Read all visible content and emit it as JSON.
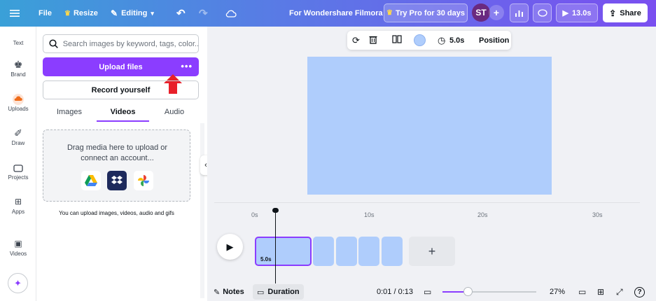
{
  "topbar": {
    "file": "File",
    "resize": "Resize",
    "editing": "Editing",
    "doc_title": "For Wondershare Filmora",
    "try_pro": "Try Pro for 30 days",
    "avatar": "ST",
    "play_duration": "13.0s",
    "share": "Share"
  },
  "rail": {
    "text": "Text",
    "brand": "Brand",
    "uploads": "Uploads",
    "draw": "Draw",
    "projects": "Projects",
    "apps": "Apps",
    "videos": "Videos"
  },
  "panel": {
    "search_placeholder": "Search images by keyword, tags, color...",
    "upload_label": "Upload files",
    "record_label": "Record yourself",
    "tabs": [
      "Images",
      "Videos",
      "Audio"
    ],
    "drop_text": "Drag media here to upload or connect an account...",
    "hint": "You can upload images, videos, audio and gifs"
  },
  "context_toolbar": {
    "duration": "5.0s",
    "position": "Position"
  },
  "timeline": {
    "ticks": [
      "0s",
      "10s",
      "20s",
      "30s"
    ],
    "clip_duration": "5.0s"
  },
  "bottom": {
    "notes": "Notes",
    "duration": "Duration",
    "time": "0:01 / 0:13",
    "zoom": "27%",
    "zoom_value": 0.27
  },
  "colors": {
    "accent": "#8b3dff",
    "canvas": "#afcdfc",
    "arrow": "#e8202a"
  }
}
